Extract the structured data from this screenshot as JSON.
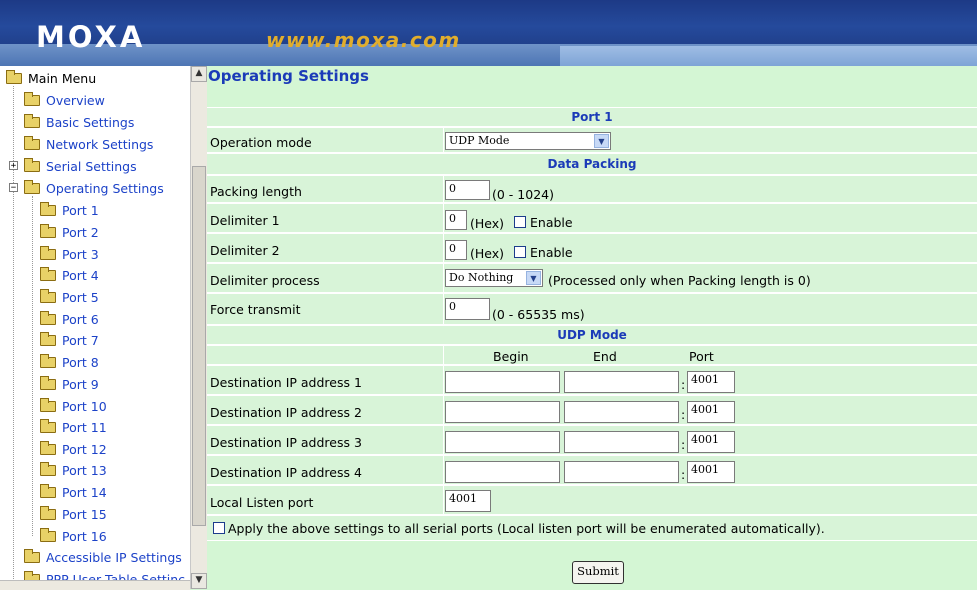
{
  "header": {
    "logo": "MOXA",
    "url": "www.moxa.com"
  },
  "menu": {
    "root": "Main Menu",
    "items": [
      {
        "label": "Overview"
      },
      {
        "label": "Basic Settings"
      },
      {
        "label": "Network Settings"
      },
      {
        "label": "Serial Settings"
      },
      {
        "label": "Operating Settings"
      },
      {
        "label": "Port 1"
      },
      {
        "label": "Port 2"
      },
      {
        "label": "Port 3"
      },
      {
        "label": "Port 4"
      },
      {
        "label": "Port 5"
      },
      {
        "label": "Port 6"
      },
      {
        "label": "Port 7"
      },
      {
        "label": "Port 8"
      },
      {
        "label": "Port 9"
      },
      {
        "label": "Port 10"
      },
      {
        "label": "Port 11"
      },
      {
        "label": "Port 12"
      },
      {
        "label": "Port 13"
      },
      {
        "label": "Port 14"
      },
      {
        "label": "Port 15"
      },
      {
        "label": "Port 16"
      },
      {
        "label": "Accessible IP Settings"
      },
      {
        "label": "PPP User Table Settinc"
      }
    ]
  },
  "page": {
    "title": "Operating Settings"
  },
  "form": {
    "port_header": "Port 1",
    "operation_mode": {
      "label": "Operation mode",
      "value": "UDP Mode"
    },
    "data_packing_header": "Data Packing",
    "packing_length": {
      "label": "Packing length",
      "value": "0",
      "hint": "(0 - 1024)"
    },
    "delimiter1": {
      "label": "Delimiter 1",
      "value": "0",
      "hex": "(Hex)",
      "enable": "Enable"
    },
    "delimiter2": {
      "label": "Delimiter 2",
      "value": "0",
      "hex": "(Hex)",
      "enable": "Enable"
    },
    "delimiter_process": {
      "label": "Delimiter process",
      "value": "Do Nothing",
      "hint": "(Processed only when Packing length is 0)"
    },
    "force_transmit": {
      "label": "Force transmit",
      "value": "0",
      "hint": "(0 - 65535 ms)"
    },
    "udp_header": "UDP Mode",
    "col_begin": "Begin",
    "col_end": "End",
    "col_port": "Port",
    "destinations": [
      {
        "label": "Destination IP address 1",
        "begin": "",
        "end": "",
        "port": "4001"
      },
      {
        "label": "Destination IP address 2",
        "begin": "",
        "end": "",
        "port": "4001"
      },
      {
        "label": "Destination IP address 3",
        "begin": "",
        "end": "",
        "port": "4001"
      },
      {
        "label": "Destination IP address 4",
        "begin": "",
        "end": "",
        "port": "4001"
      }
    ],
    "colon": ":",
    "local_listen": {
      "label": "Local Listen port",
      "value": "4001"
    },
    "apply_all": "Apply the above settings to all serial ports (Local listen port will be enumerated automatically).",
    "submit": "Submit"
  }
}
